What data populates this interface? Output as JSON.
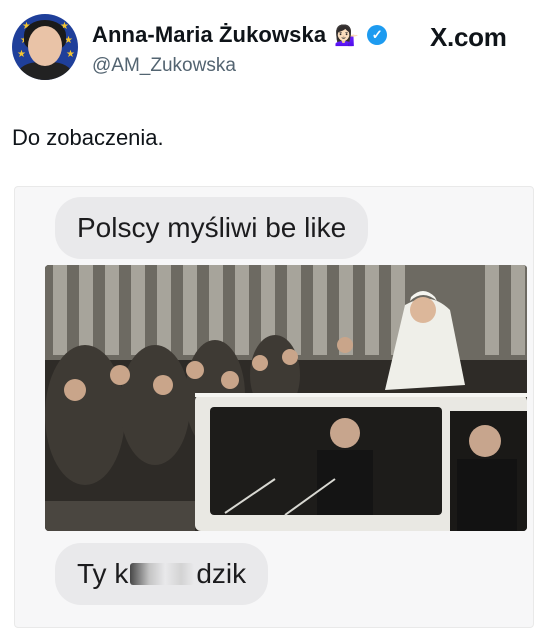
{
  "author": {
    "name": "Anna-Maria Żukowska",
    "emoji": "💁🏻‍♀️",
    "handle": "@AM_Zukowska"
  },
  "watermark": "X.com",
  "tweet": {
    "text": "Do zobaczenia."
  },
  "meme": {
    "top_message": "Polscy myśliwi be like",
    "bottom_before": "Ty k",
    "bottom_after": "dzik"
  },
  "colors": {
    "verified": "#1d9bf0",
    "bubble": "#e9e9eb",
    "handle": "#536471"
  }
}
